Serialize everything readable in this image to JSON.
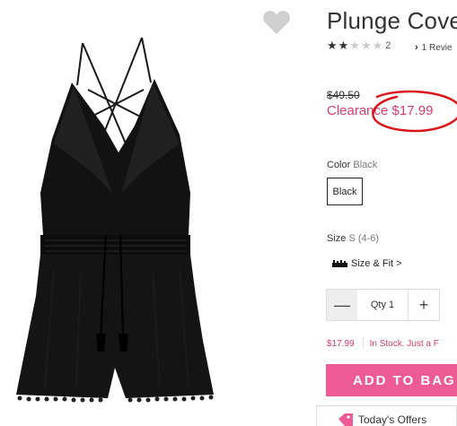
{
  "product": {
    "title": "Plunge Cove",
    "rating": {
      "count": "2",
      "filled_stars": 2,
      "total_stars": 5
    },
    "reviews_link": "1 Revie",
    "original_price": "$49.50",
    "clearance_price": "Clearance $17.99",
    "color": {
      "label": "Color",
      "value": "Black",
      "swatch": "Black"
    },
    "size": {
      "label": "Size",
      "value": "S (4-6)",
      "fit_link": "Size & Fit >"
    },
    "quantity": {
      "minus": "—",
      "text": "Qty 1",
      "plus": "+"
    },
    "price_small": "$17.99",
    "stock_status": "In Stock. Just a F",
    "add_to_bag": "ADD TO BAG",
    "offers": "Today's Offers"
  },
  "icons": {
    "favorite": "heart-icon",
    "size_fit": "ruler-icon",
    "offers": "tag-icon",
    "reviews": "chevron-right-icon"
  },
  "colors": {
    "accent_pink": "#ee5b94",
    "clearance_pink": "#d63c6f",
    "annotation_red": "#d9141a"
  }
}
